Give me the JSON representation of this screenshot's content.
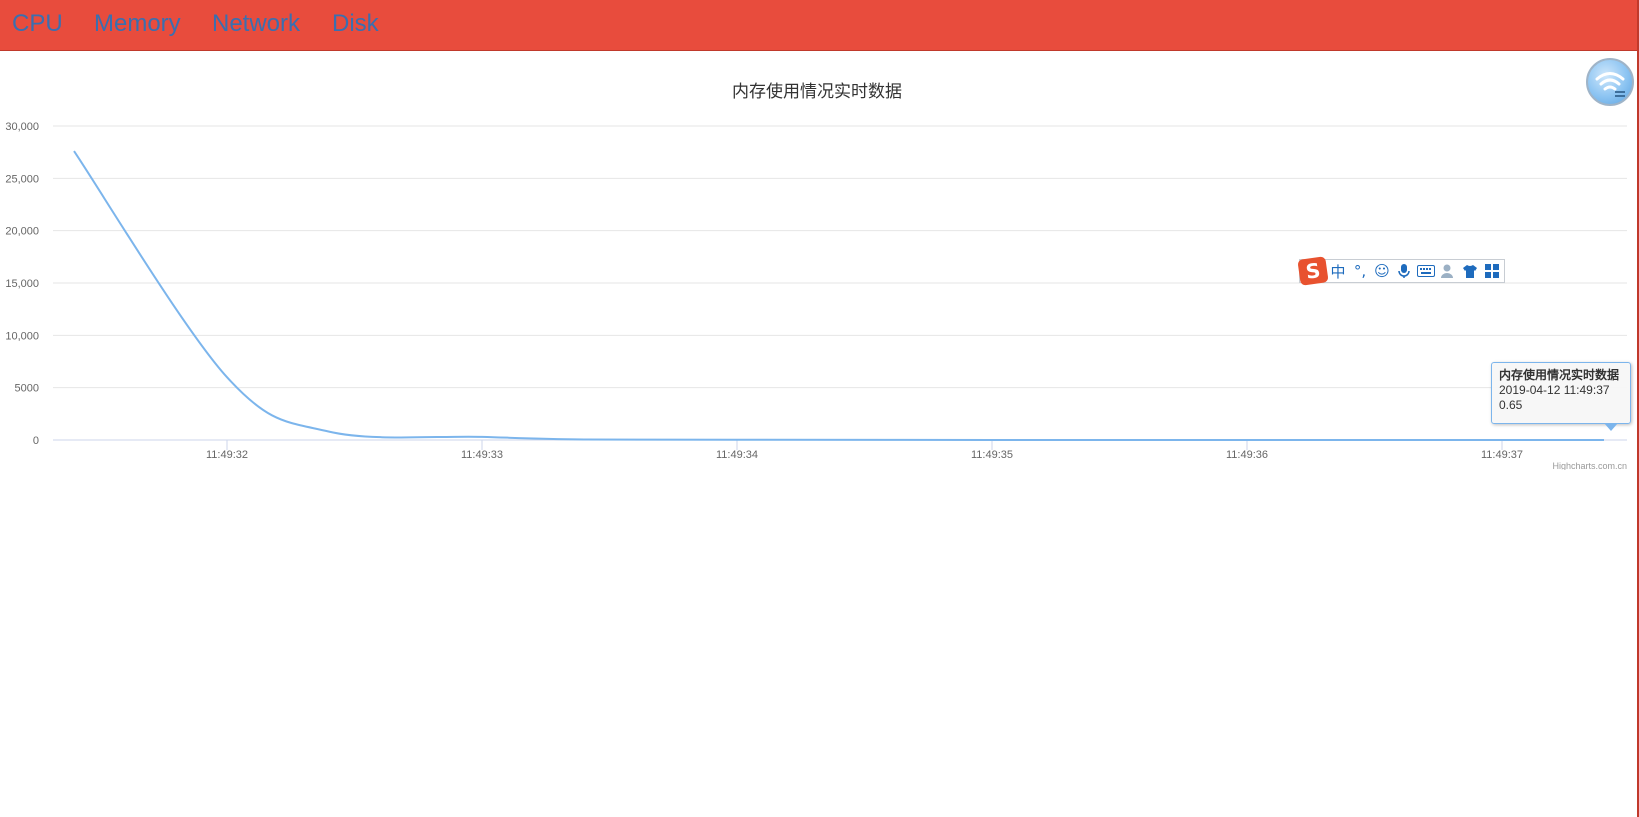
{
  "nav": {
    "items": [
      {
        "label": "CPU"
      },
      {
        "label": "Memory"
      },
      {
        "label": "Network"
      },
      {
        "label": "Disk"
      }
    ]
  },
  "chart_data": {
    "type": "line",
    "title": "内存使用情况实时数据",
    "xlabel": "",
    "ylabel": "",
    "y_ticks": [
      "0",
      "5000",
      "10,000",
      "15,000",
      "20,000",
      "25,000",
      "30,000"
    ],
    "ylim": [
      0,
      30000
    ],
    "x_ticks": [
      "11:49:32",
      "11:49:33",
      "11:49:34",
      "11:49:35",
      "11:49:36",
      "11:49:37"
    ],
    "grid": true,
    "legend": "none",
    "line_color": "#7cb5ec",
    "series": [
      {
        "values": [
          {
            "x": "11:49:31.4",
            "y": 27600
          },
          {
            "x": "11:49:32.0",
            "y": 6000
          },
          {
            "x": "11:49:32.4",
            "y": 800
          },
          {
            "x": "11:49:33.0",
            "y": 300
          },
          {
            "x": "11:49:33.4",
            "y": 50
          },
          {
            "x": "11:49:34.0",
            "y": 20
          },
          {
            "x": "11:49:35.0",
            "y": 5
          },
          {
            "x": "11:49:36.0",
            "y": 2
          },
          {
            "x": "11:49:37.0",
            "y": 1
          },
          {
            "x": "11:49:37.4",
            "y": 0.65
          }
        ]
      }
    ]
  },
  "tooltip": {
    "title": "内存使用情况实时数据",
    "time": "2019-04-12 11:49:37",
    "value": "0.65"
  },
  "credit": "Highcharts.com.cn",
  "ime_toolbar": {
    "logo": "S",
    "buttons": [
      {
        "icon": "zhong-icon",
        "glyph": "中"
      },
      {
        "icon": "punctuation-icon",
        "glyph": "°,"
      },
      {
        "icon": "emoji-icon",
        "glyph": "☺"
      },
      {
        "icon": "microphone-icon",
        "glyph": "🎤"
      },
      {
        "icon": "keyboard-icon",
        "glyph": "⌨"
      },
      {
        "icon": "user-icon",
        "glyph": "👤"
      },
      {
        "icon": "shirt-icon",
        "glyph": "👕"
      },
      {
        "icon": "grid-icon",
        "glyph": "▦"
      }
    ]
  },
  "floating_widget": {
    "icon": "wifi-icon"
  }
}
